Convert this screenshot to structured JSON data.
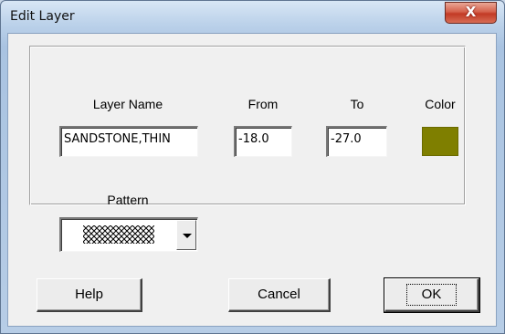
{
  "window": {
    "title": "Edit Layer",
    "close_symbol": "X"
  },
  "labels": {
    "layer_name": "Layer Name",
    "from": "From",
    "to": "To",
    "color": "Color",
    "pattern": "Pattern"
  },
  "fields": {
    "layer_name_value": "SANDSTONE,THIN",
    "from_value": "-18.0",
    "to_value": "-27.0"
  },
  "color": {
    "swatch": "#7f7f00"
  },
  "pattern": {
    "selected": "crosshatch-pattern"
  },
  "buttons": {
    "help": "Help",
    "cancel": "Cancel",
    "ok": "OK"
  }
}
